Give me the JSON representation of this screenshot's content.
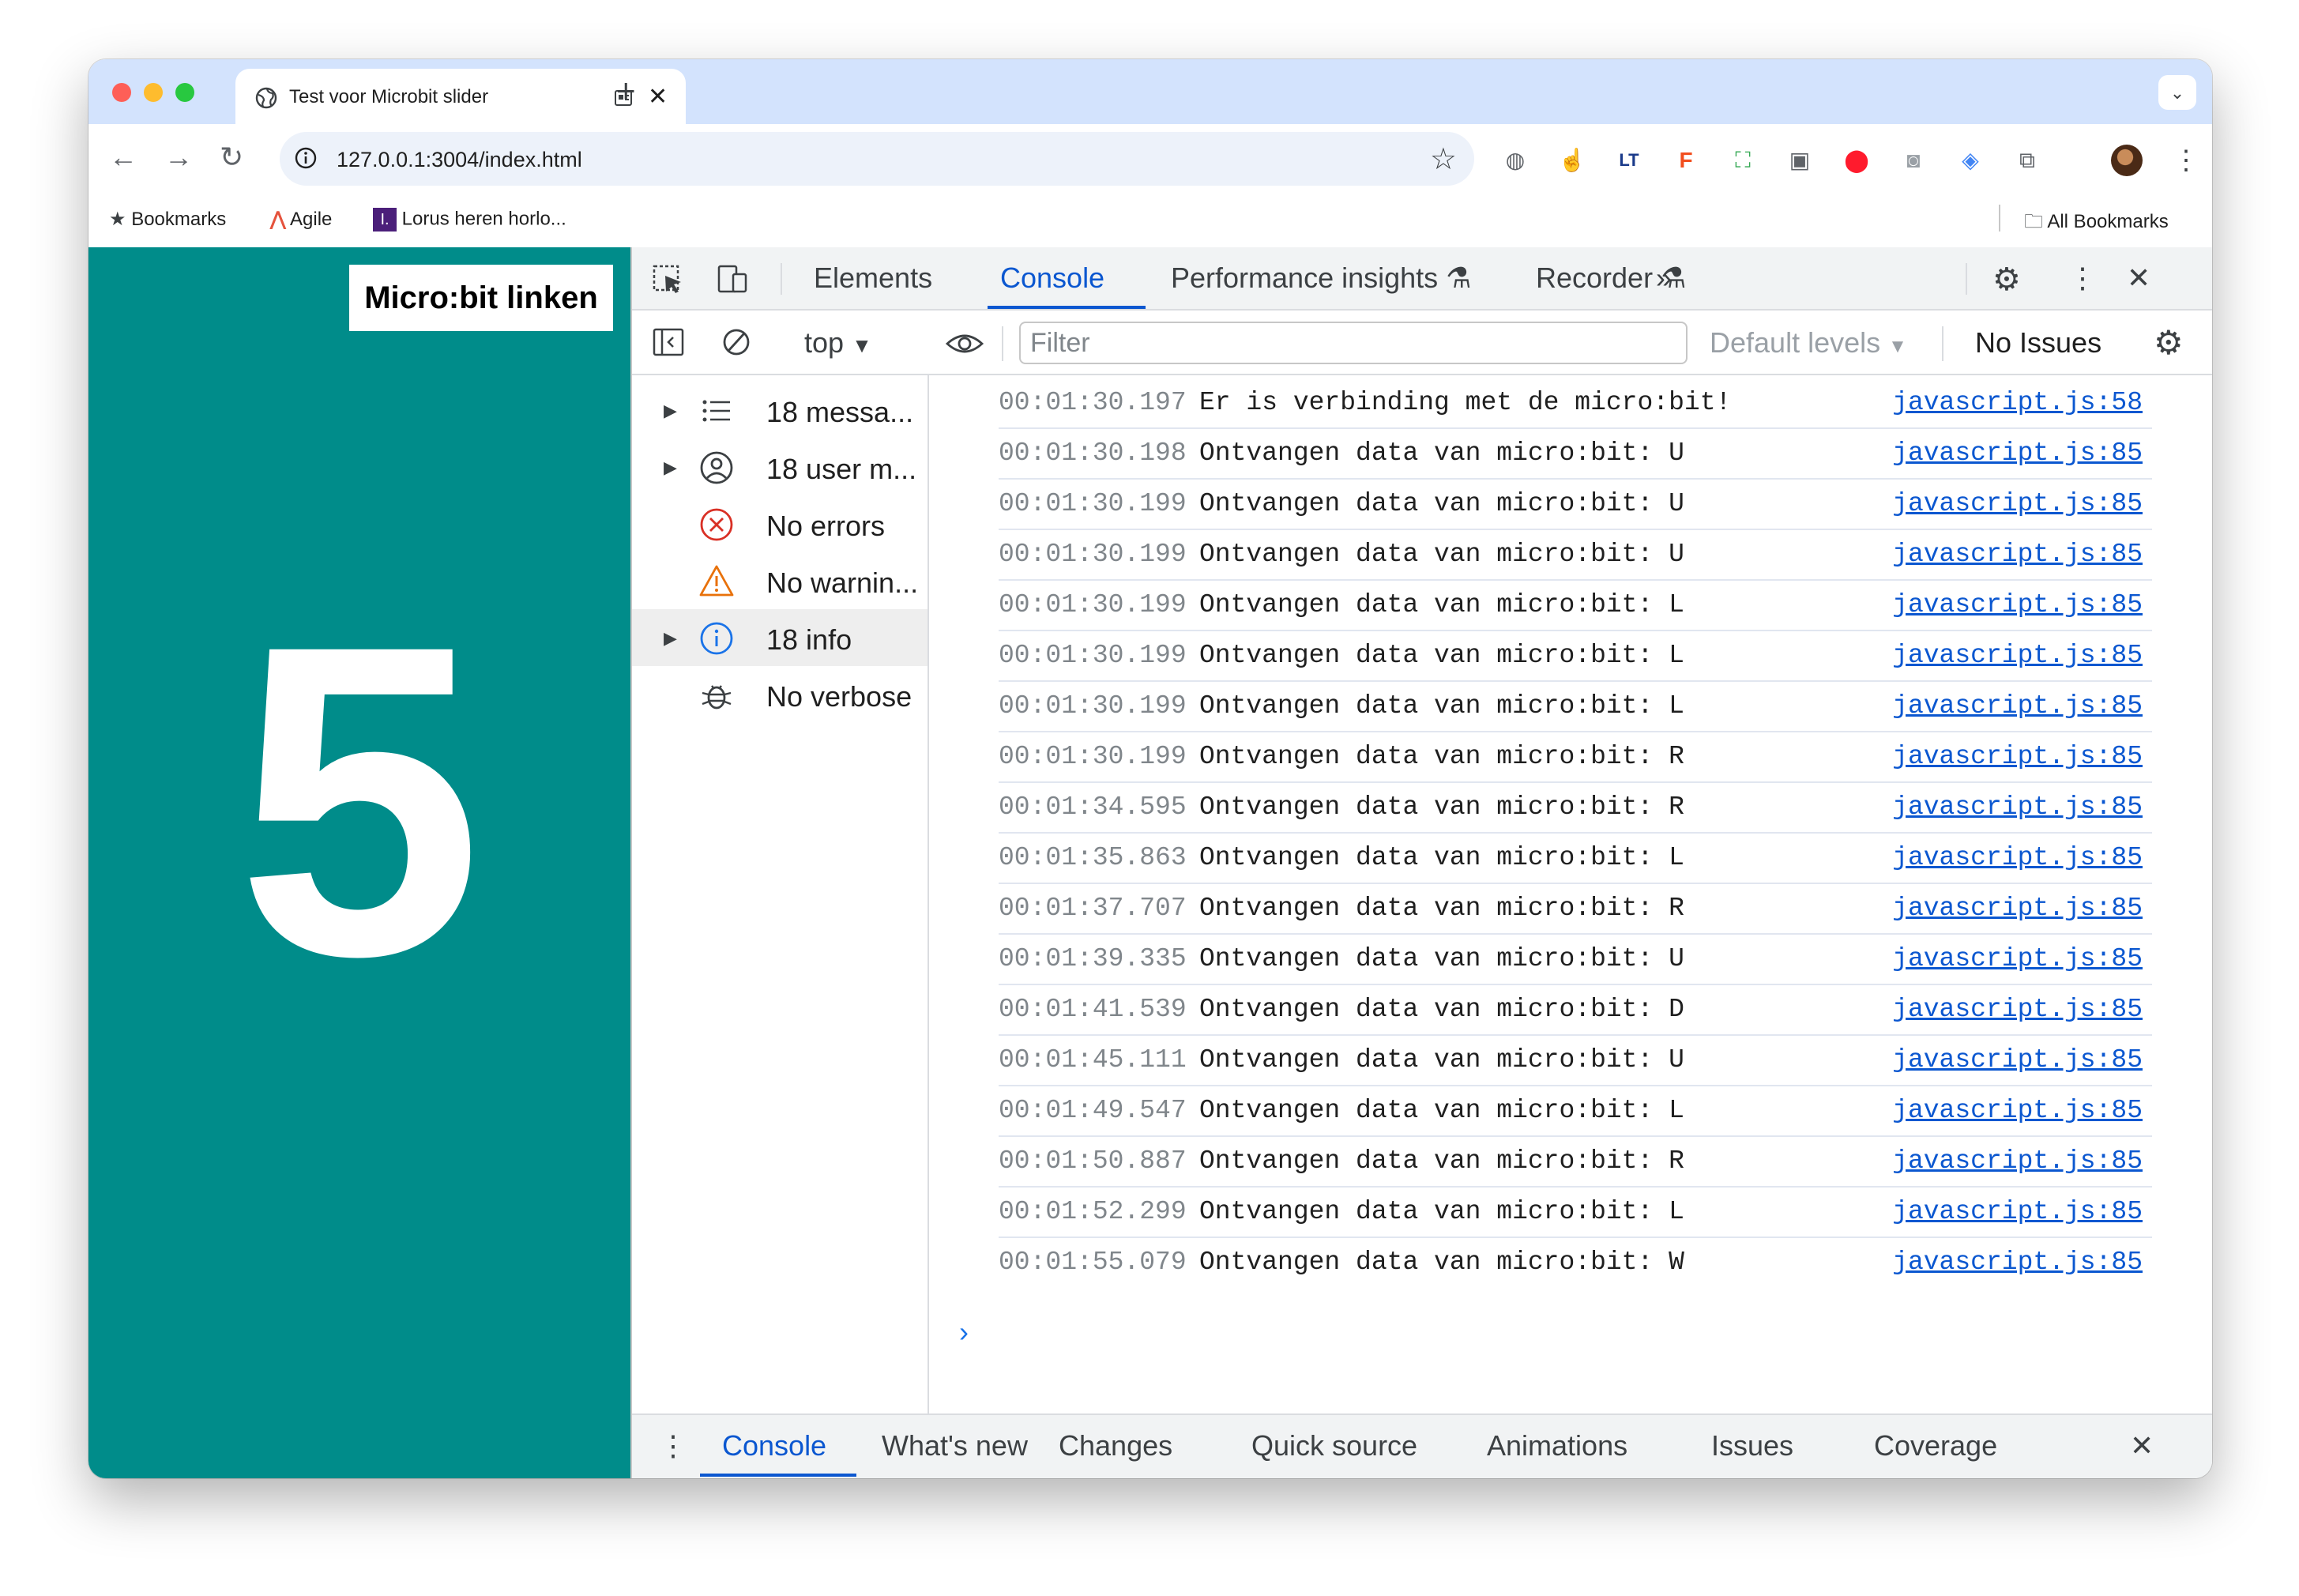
{
  "browser": {
    "tab_title": "Test voor Microbit slider",
    "url": "127.0.0.1:3004/index.html",
    "bookmarks": [
      {
        "label": "Bookmarks"
      },
      {
        "label": "Agile"
      },
      {
        "label": "Lorus heren horlo..."
      }
    ],
    "all_bookmarks": "All Bookmarks"
  },
  "page": {
    "button_label": "Micro:bit linken",
    "big_number": "5",
    "background_color": "#008c8a"
  },
  "devtools": {
    "tabs": [
      "Elements",
      "Console",
      "Performance insights",
      "Recorder"
    ],
    "active_tab": "Console",
    "context": "top",
    "filter_placeholder": "Filter",
    "levels": "Default levels",
    "issues": "No Issues",
    "sidebar": [
      {
        "label": "18 messa...",
        "icon": "list-icon",
        "expandable": true
      },
      {
        "label": "18 user m...",
        "icon": "user-icon",
        "expandable": true
      },
      {
        "label": "No errors",
        "icon": "error-icon",
        "expandable": false
      },
      {
        "label": "No warnin...",
        "icon": "warning-icon",
        "expandable": false
      },
      {
        "label": "18 info",
        "icon": "info-icon",
        "expandable": true,
        "selected": true
      },
      {
        "label": "No verbose",
        "icon": "bug-icon",
        "expandable": false
      }
    ],
    "messages": [
      {
        "ts": "00:01:30.197",
        "text": "Er is verbinding met de micro:bit!",
        "src": "javascript.js:58"
      },
      {
        "ts": "00:01:30.198",
        "text": "Ontvangen data van micro:bit: U",
        "src": "javascript.js:85"
      },
      {
        "ts": "00:01:30.199",
        "text": "Ontvangen data van micro:bit: U",
        "src": "javascript.js:85"
      },
      {
        "ts": "00:01:30.199",
        "text": "Ontvangen data van micro:bit: U",
        "src": "javascript.js:85"
      },
      {
        "ts": "00:01:30.199",
        "text": "Ontvangen data van micro:bit: L",
        "src": "javascript.js:85"
      },
      {
        "ts": "00:01:30.199",
        "text": "Ontvangen data van micro:bit: L",
        "src": "javascript.js:85"
      },
      {
        "ts": "00:01:30.199",
        "text": "Ontvangen data van micro:bit: L",
        "src": "javascript.js:85"
      },
      {
        "ts": "00:01:30.199",
        "text": "Ontvangen data van micro:bit: R",
        "src": "javascript.js:85"
      },
      {
        "ts": "00:01:34.595",
        "text": "Ontvangen data van micro:bit: R",
        "src": "javascript.js:85"
      },
      {
        "ts": "00:01:35.863",
        "text": "Ontvangen data van micro:bit: L",
        "src": "javascript.js:85"
      },
      {
        "ts": "00:01:37.707",
        "text": "Ontvangen data van micro:bit: R",
        "src": "javascript.js:85"
      },
      {
        "ts": "00:01:39.335",
        "text": "Ontvangen data van micro:bit: U",
        "src": "javascript.js:85"
      },
      {
        "ts": "00:01:41.539",
        "text": "Ontvangen data van micro:bit: D",
        "src": "javascript.js:85"
      },
      {
        "ts": "00:01:45.111",
        "text": "Ontvangen data van micro:bit: U",
        "src": "javascript.js:85"
      },
      {
        "ts": "00:01:49.547",
        "text": "Ontvangen data van micro:bit: L",
        "src": "javascript.js:85"
      },
      {
        "ts": "00:01:50.887",
        "text": "Ontvangen data van micro:bit: R",
        "src": "javascript.js:85"
      },
      {
        "ts": "00:01:52.299",
        "text": "Ontvangen data van micro:bit: L",
        "src": "javascript.js:85"
      },
      {
        "ts": "00:01:55.079",
        "text": "Ontvangen data van micro:bit: W",
        "src": "javascript.js:85"
      }
    ],
    "drawer_tabs": [
      "Console",
      "What's new",
      "Changes",
      "Quick source",
      "Animations",
      "Issues",
      "Coverage"
    ]
  }
}
